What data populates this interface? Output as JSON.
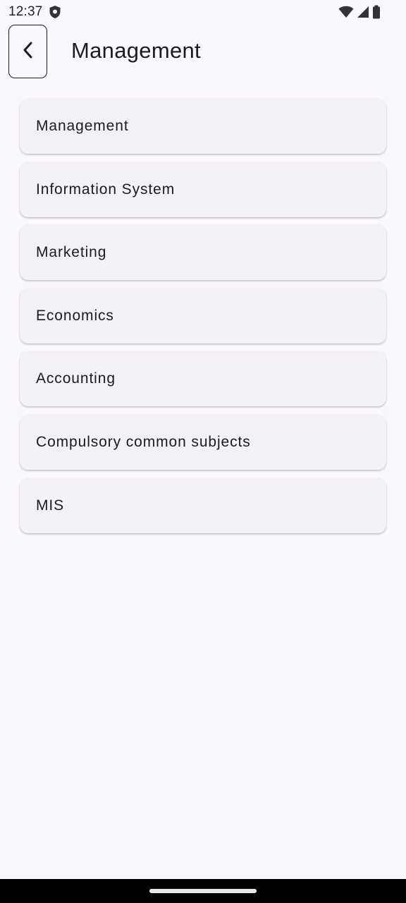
{
  "status_bar": {
    "time": "12:37",
    "icons": [
      "shield-icon",
      "wifi-icon",
      "signal-icon",
      "battery-icon"
    ]
  },
  "app_bar": {
    "back_icon": "chevron-left-icon",
    "title": "Management"
  },
  "list": {
    "items": [
      {
        "label": "Management"
      },
      {
        "label": "Information System"
      },
      {
        "label": "Marketing"
      },
      {
        "label": "Economics"
      },
      {
        "label": "Accounting"
      },
      {
        "label": "Compulsory common subjects"
      },
      {
        "label": "MIS"
      }
    ]
  },
  "colors": {
    "background": "#fbf8fd",
    "card": "#f4f1f6",
    "text": "#1c1b1f",
    "nav_bar": "#000000"
  }
}
